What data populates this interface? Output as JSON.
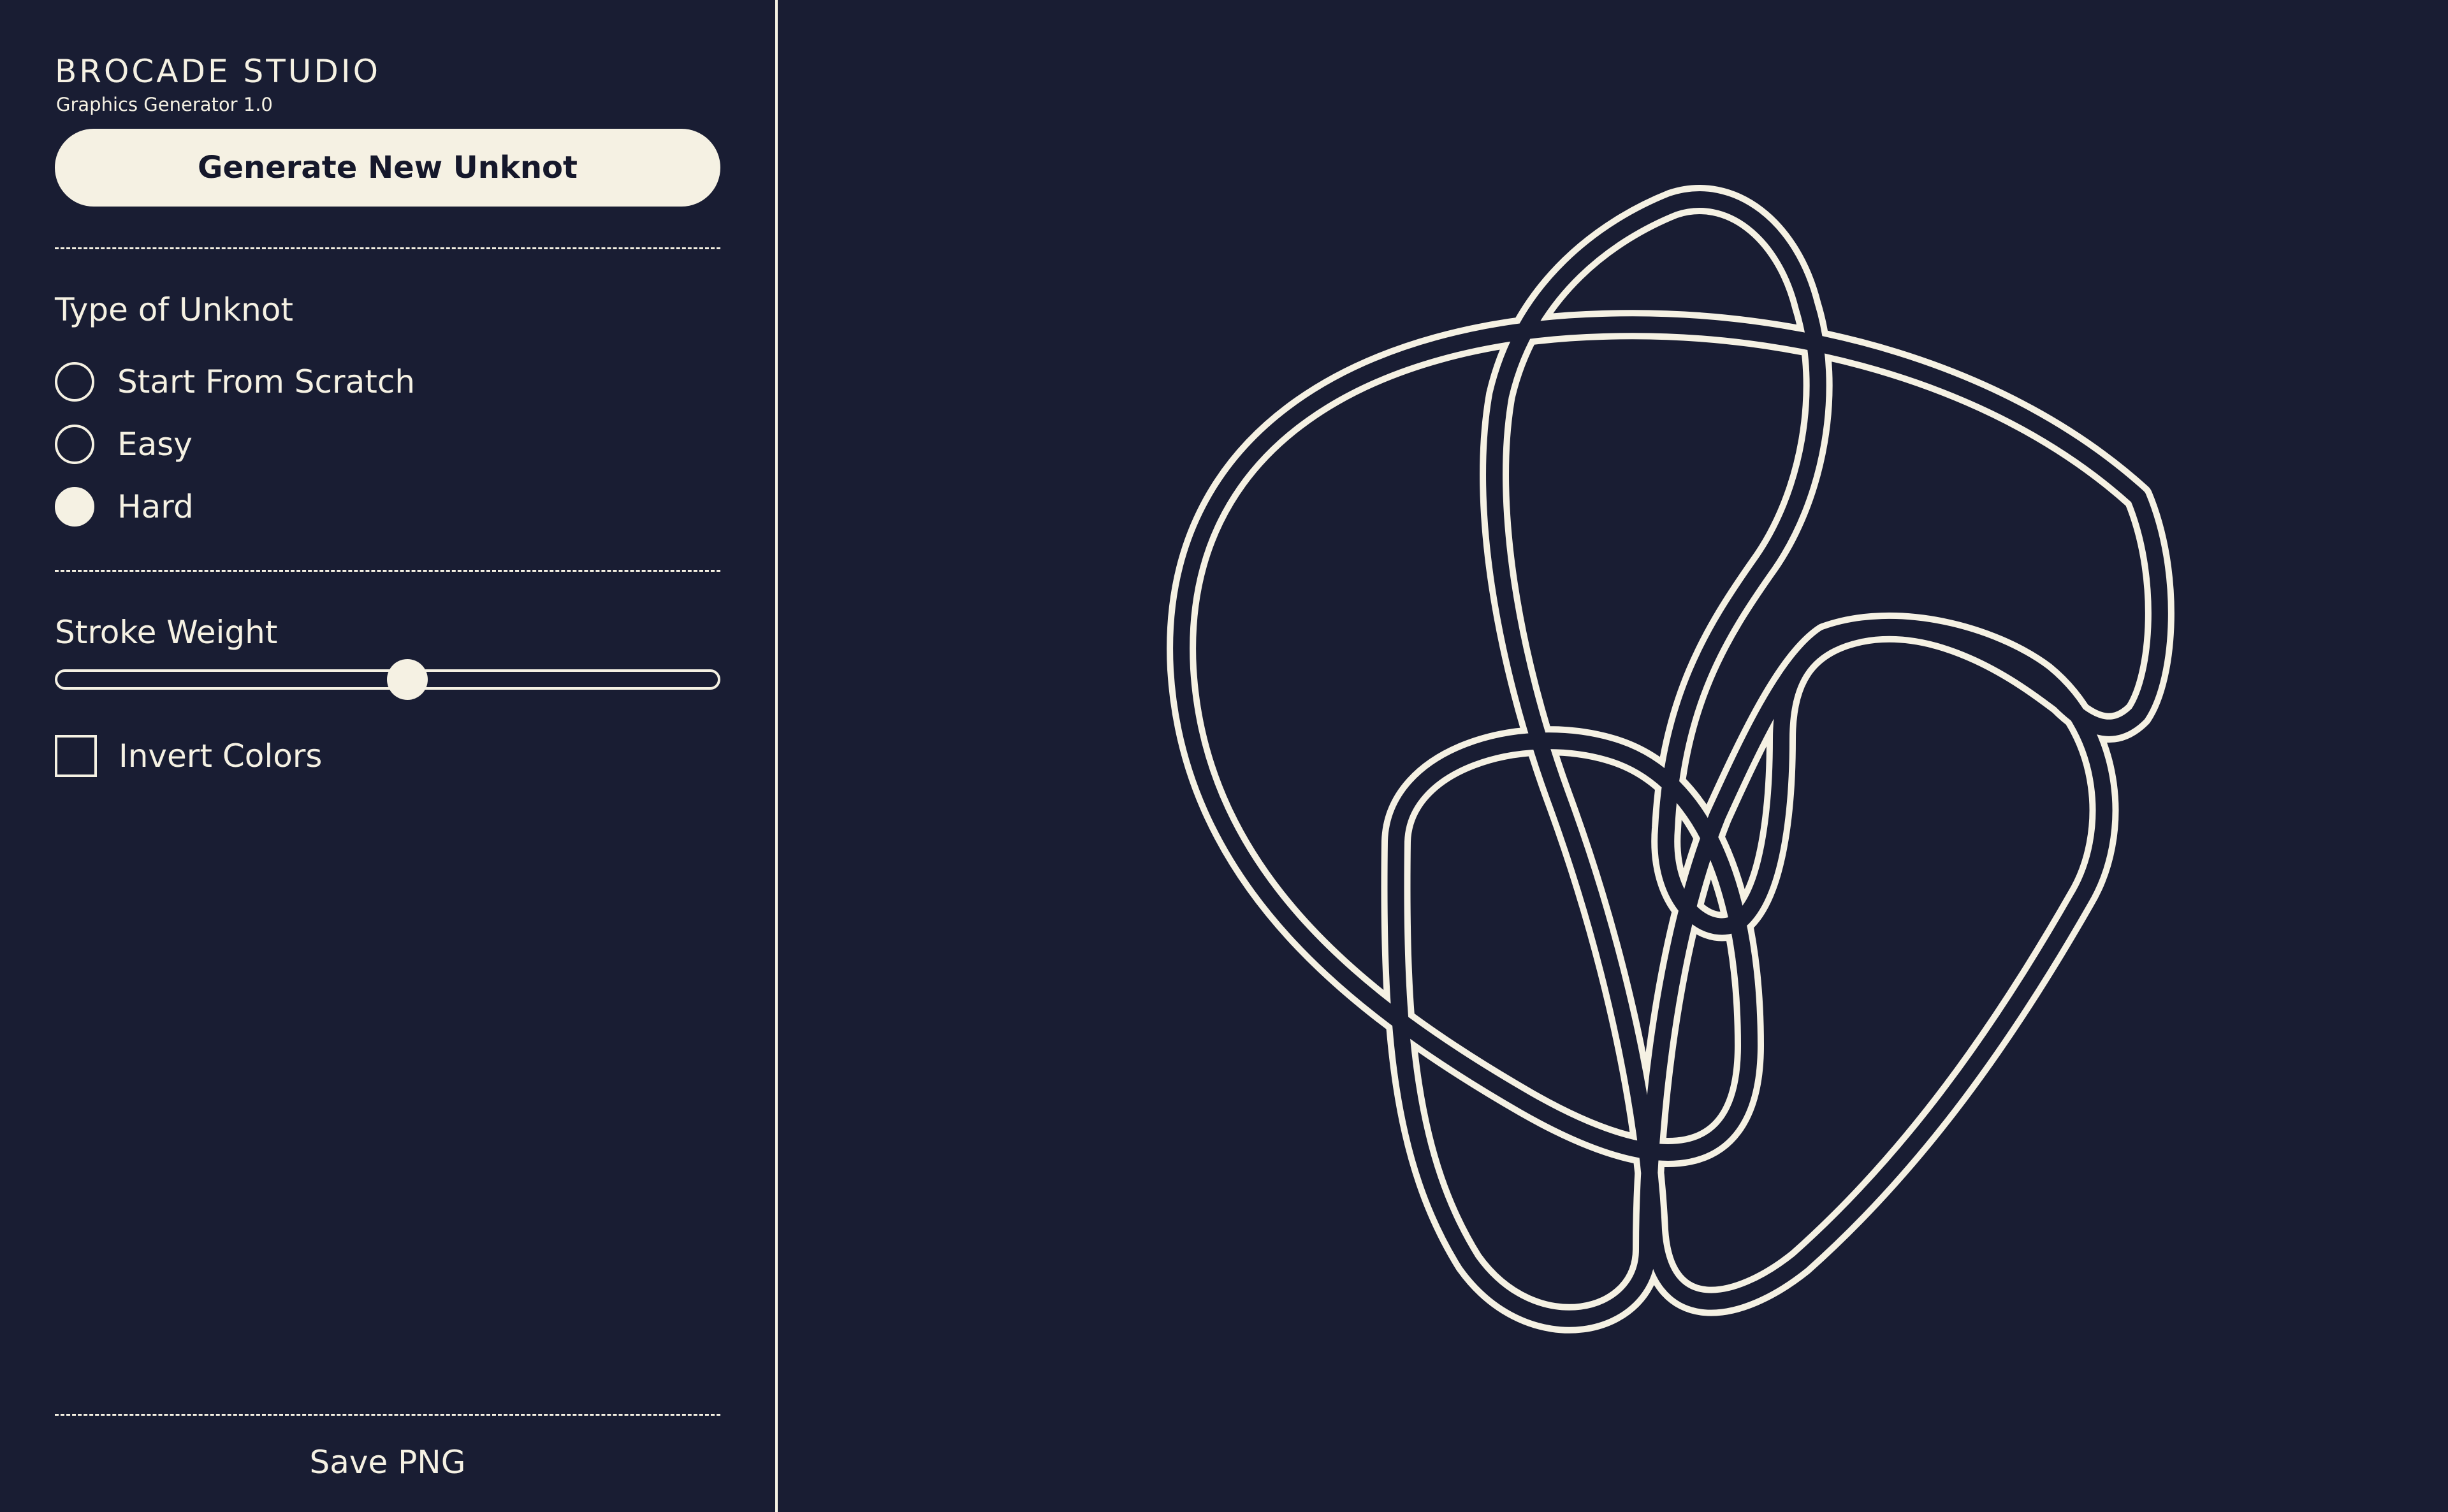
{
  "brand": {
    "title": "BROCADE STUDIO",
    "subtitle": "Graphics Generator 1.0"
  },
  "actions": {
    "generate_label": "Generate New Unknot",
    "save_label": "Save PNG"
  },
  "unknot_type": {
    "label": "Type of Unknot",
    "options": [
      {
        "label": "Start From Scratch",
        "checked": false
      },
      {
        "label": "Easy",
        "checked": false
      },
      {
        "label": "Hard",
        "checked": true
      }
    ]
  },
  "stroke_weight": {
    "label": "Stroke Weight",
    "value": 0.53
  },
  "invert_colors": {
    "label": "Invert Colors",
    "checked": false
  },
  "colors": {
    "background": "#191d33",
    "foreground": "#f5f1e3"
  }
}
